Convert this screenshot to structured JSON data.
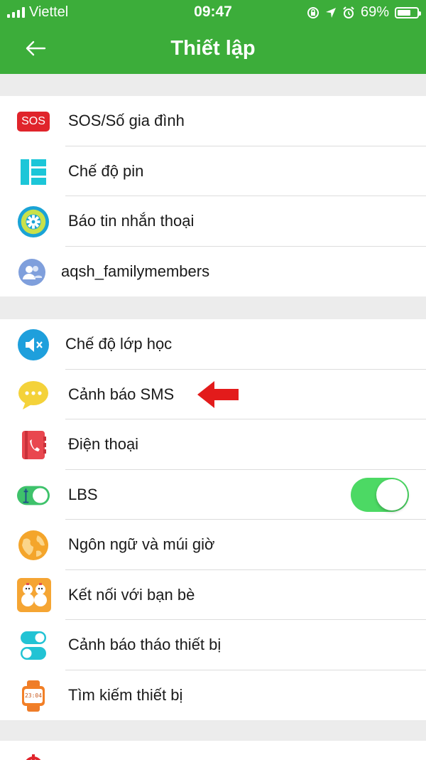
{
  "status_bar": {
    "carrier": "Viettel",
    "time": "09:47",
    "battery": "69%",
    "battery_level": 0.69
  },
  "header": {
    "title": "Thiết lập"
  },
  "groups": [
    {
      "items": [
        {
          "label": "SOS/Số gia đình",
          "icon": "sos-icon",
          "icon_text": "SOS"
        },
        {
          "label": "Chế độ pin",
          "icon": "battery-mode-icon"
        },
        {
          "label": "Báo tin nhắn thoại",
          "icon": "gear-icon"
        },
        {
          "label": "aqsh_familymembers",
          "icon": "family-members-icon"
        }
      ]
    },
    {
      "items": [
        {
          "label": "Chế độ lớp học",
          "icon": "speaker-mute-icon"
        },
        {
          "label": "Cảnh báo SMS",
          "icon": "chat-bubble-icon"
        },
        {
          "label": "Điện thoại",
          "icon": "phonebook-icon"
        },
        {
          "label": "LBS",
          "icon": "lbs-toggle-icon",
          "toggle_on": true
        },
        {
          "label": "Ngôn ngữ và múi giờ",
          "icon": "globe-icon"
        },
        {
          "label": "Kết nối với bạn bè",
          "icon": "snowmen-friends-icon"
        },
        {
          "label": "Cảnh báo tháo thiết bị",
          "icon": "switches-icon"
        },
        {
          "label": "Tìm kiếm thiết bị",
          "icon": "watch-icon",
          "icon_text": "23:04"
        }
      ]
    }
  ],
  "colors": {
    "header_green": "#3cad3a",
    "toggle_green": "#4cd964",
    "annotation_arrow": "#e31b1b"
  }
}
